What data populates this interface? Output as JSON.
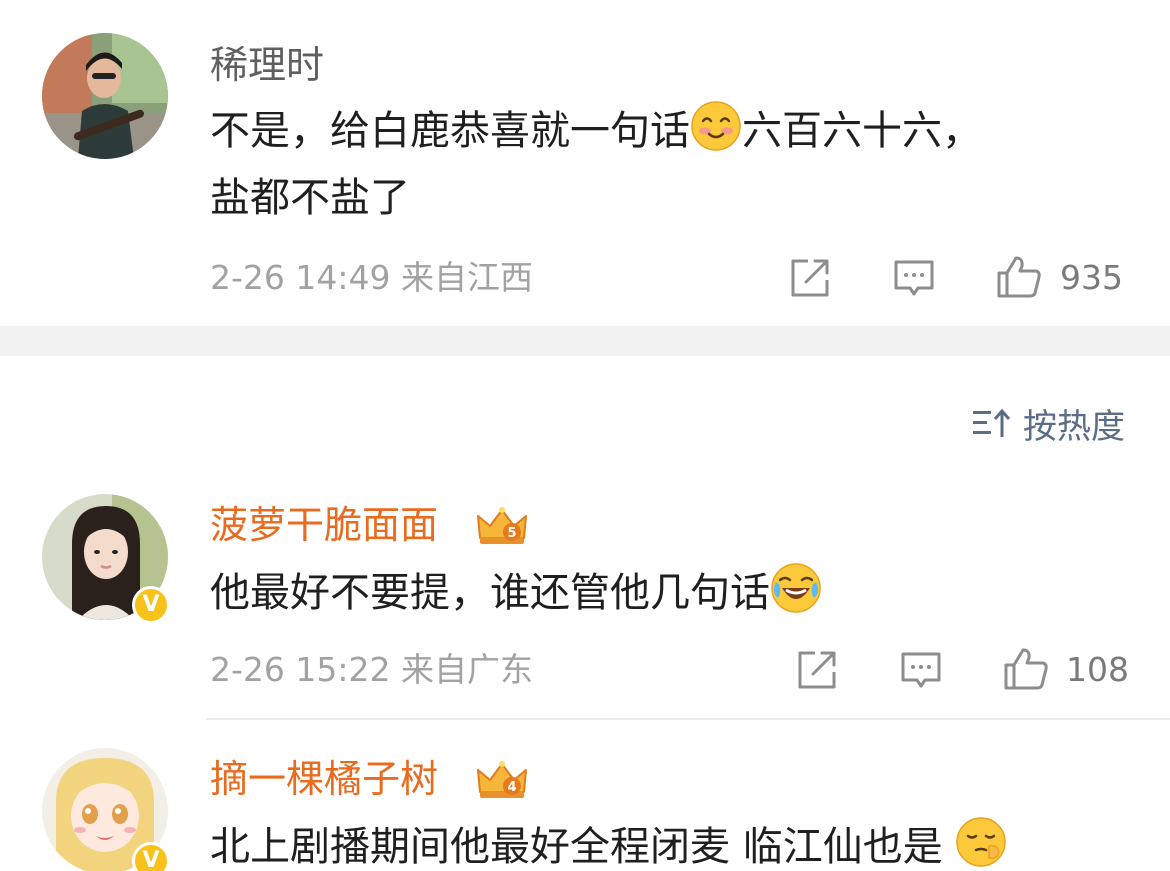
{
  "comments": [
    {
      "username": "稀理时",
      "text_line1": "不是，给白鹿恭喜就一句话",
      "text_line1_after_emoji": "六百六十六，",
      "text_line2": "盐都不盐了",
      "emoji_1": "smile-emoji",
      "date": "2-26 14:49",
      "location": "来自江西",
      "likes": "935"
    },
    {
      "username": "菠萝干脆面面",
      "level_badge": "5",
      "verified": true,
      "text_line1": "他最好不要提，谁还管他几句话",
      "emoji_1": "laugh-cry-emoji",
      "date": "2-26 15:22",
      "location": "来自广东",
      "likes": "108"
    },
    {
      "username": "摘一棵橘子树",
      "level_badge": "4",
      "verified": true,
      "text_line1": "北上剧播期间他最好全程闭麦 临江仙也是",
      "emoji_1": "shush-emoji"
    }
  ],
  "sort": {
    "label": "按热度",
    "icon": "sort-icon"
  },
  "colors": {
    "username_gray": "#5f5f5f",
    "username_vip": "#e86b1f",
    "sort_blue": "#5b6c87",
    "meta_gray": "#a2a2a2",
    "verified_yellow": "#f8c21b"
  },
  "verified_mark": "V"
}
